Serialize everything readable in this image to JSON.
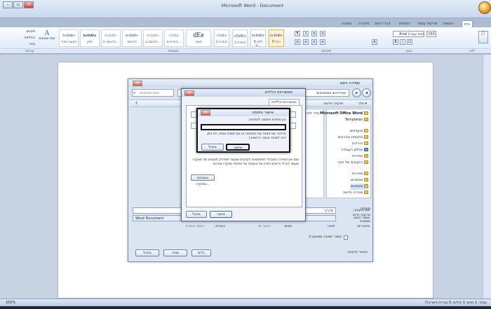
{
  "window": {
    "title": "Microsoft Word - Document"
  },
  "ribbon": {
    "tabs": [
      "בית",
      "הוספה",
      "פריסת עמוד",
      "הפניות",
      "דברי דואר",
      "סקירה",
      "תצוגה"
    ],
    "styles": [
      {
        "preview": "bcDdEe",
        "name": "¶ רגיל"
      },
      {
        "preview": "bcDdEe",
        "name": "¶ ללא מ..."
      },
      {
        "preview": "cDdEe",
        "name": "כותרת 1"
      },
      {
        "preview": "cDdEe",
        "name": "כותרת 2"
      },
      {
        "preview": "dEe",
        "name": "תואר"
      },
      {
        "preview": "cDdEe",
        "name": "כותרת מ..."
      },
      {
        "preview": "bcDdEe",
        "name": "הדגשה ע..."
      },
      {
        "preview": "bcDdEe",
        "name": "הדגשה"
      },
      {
        "preview": "bcDdEe",
        "name": "הדגשה ח..."
      },
      {
        "preview": "bcDdEe",
        "name": "חזק"
      },
      {
        "preview": "bcDdEe",
        "name": "הצעת מחיר"
      }
    ],
    "change_styles_label": "שנה סגנונות",
    "edit_items": [
      "חיפוש",
      "החלפה",
      "בחר"
    ],
    "font_name": "(גוף עברי) Arial",
    "font_size": "150",
    "group_labels": [
      "לוח",
      "גופן",
      "פיסקה",
      "סגנונות",
      "עריכה"
    ]
  },
  "save_dialog": {
    "title": "שמירה בשם",
    "address": "ספריות ◂ מסמכים ◂",
    "search_placeholder": "חפש מסמכים",
    "toolbar_organize": "סדר ▾",
    "toolbar_new_folder": "תיקייה חדשה",
    "view_label": "סדר לפי: תיקייה ▾",
    "column_type": "גודל",
    "nav_items": [
      "Microsoft Office Word",
      "Templates",
      "מועדפים",
      "מקומות אחרונים",
      "הורדות",
      "שולחן העבודה",
      "ספריות",
      "הקבצים של סקיי",
      "ספריות",
      "מסמכים",
      "מסמכים",
      "ספריה חדשה",
      "מוזיקה",
      "סרטוני וידאו",
      "תמונות"
    ],
    "file_name_label": "שם הקובץ:",
    "file_name_value": "מדריך",
    "save_type_label": "שמור כסוג:",
    "save_type_value": "Word Document",
    "authors_label": "מחברים:",
    "authors_value": "user",
    "tags_label": "תגים:",
    "tags_value": "הוסף תג",
    "title_label": "כותרת:",
    "title_value": "הוסף כותרת",
    "thumbnail_label": "שמור תמונה ממוזערת",
    "tools_label": "כלים",
    "save_button": "שמור",
    "cancel_button": "ביטול",
    "hide_folders": "הסתר תיקיות"
  },
  "general_dialog": {
    "title": "אפשרויות כלליות",
    "tab": "אפשרויות כלליות",
    "note": "ושם את סמיכה המגבלה לסיסמאות הקבצים שמגאי לאפליק חסומים של מאקרו שעשוי להכיל וירוסים ולציין את השמות של מפתחי מאקרו אמינים.",
    "macro_button": "אבטחת מאקרו...",
    "ok_button": "אישור",
    "cancel_button": "ביטול"
  },
  "password_dialog": {
    "title": "אישור סיסמה",
    "prompt": "הזן מחדש סיסמה לפתיחה:",
    "hint": "זהירות: אם תאבד את הסיסמה או אם תשכח אותה, לא ניתן יהיה לשחזר אותה. (רישיות.)",
    "ok_button": "אישור",
    "cancel_button": "ביטול"
  },
  "status_bar": {
    "text": "עמוד: 1 מתוך 1   מילים: 0   עברית (ישראל)",
    "zoom": "100%"
  }
}
